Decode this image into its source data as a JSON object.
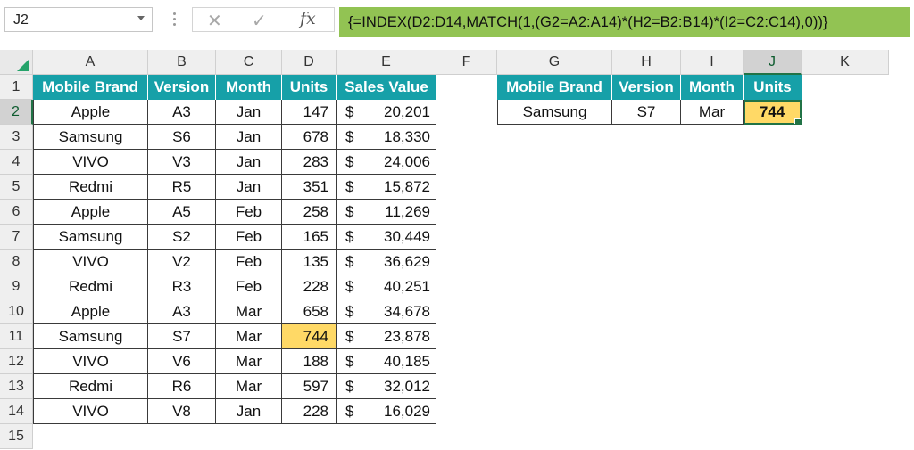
{
  "formula_bar": {
    "name_box": "J2",
    "cancel_icon": "✕",
    "enter_icon": "✓",
    "fx_label": "fx",
    "formula": "{=INDEX(D2:D14,MATCH(1,(G2=A2:A14)*(H2=B2:B14)*(I2=C2:C14),0))}"
  },
  "columns": [
    "A",
    "B",
    "C",
    "D",
    "E",
    "F",
    "G",
    "H",
    "I",
    "J",
    "K"
  ],
  "rows": [
    "1",
    "2",
    "3",
    "4",
    "5",
    "6",
    "7",
    "8",
    "9",
    "10",
    "11",
    "12",
    "13",
    "14",
    "15"
  ],
  "main_table": {
    "headers": [
      "Mobile Brand",
      "Version",
      "Month",
      "Units",
      "Sales Value"
    ],
    "currency_symbol": "$",
    "rows": [
      {
        "brand": "Apple",
        "version": "A3",
        "month": "Jan",
        "units": "147",
        "sales": "20,201"
      },
      {
        "brand": "Samsung",
        "version": "S6",
        "month": "Jan",
        "units": "678",
        "sales": "18,330"
      },
      {
        "brand": "VIVO",
        "version": "V3",
        "month": "Jan",
        "units": "283",
        "sales": "24,006"
      },
      {
        "brand": "Redmi",
        "version": "R5",
        "month": "Jan",
        "units": "351",
        "sales": "15,872"
      },
      {
        "brand": "Apple",
        "version": "A5",
        "month": "Feb",
        "units": "258",
        "sales": "11,269"
      },
      {
        "brand": "Samsung",
        "version": "S2",
        "month": "Feb",
        "units": "165",
        "sales": "30,449"
      },
      {
        "brand": "VIVO",
        "version": "V2",
        "month": "Feb",
        "units": "135",
        "sales": "36,629"
      },
      {
        "brand": "Redmi",
        "version": "R3",
        "month": "Feb",
        "units": "228",
        "sales": "40,251"
      },
      {
        "brand": "Apple",
        "version": "A3",
        "month": "Mar",
        "units": "658",
        "sales": "34,678"
      },
      {
        "brand": "Samsung",
        "version": "S7",
        "month": "Mar",
        "units": "744",
        "sales": "23,878",
        "highlight": true
      },
      {
        "brand": "VIVO",
        "version": "V6",
        "month": "Mar",
        "units": "188",
        "sales": "40,185"
      },
      {
        "brand": "Redmi",
        "version": "R6",
        "month": "Mar",
        "units": "597",
        "sales": "32,012"
      },
      {
        "brand": "VIVO",
        "version": "V8",
        "month": "Jan",
        "units": "228",
        "sales": "16,029"
      }
    ]
  },
  "lookup_table": {
    "headers": [
      "Mobile Brand",
      "Version",
      "Month",
      "Units"
    ],
    "brand": "Samsung",
    "version": "S7",
    "month": "Mar",
    "result": "744"
  },
  "colors": {
    "header_fill": "#16a0a8",
    "highlight_fill": "#ffd966",
    "formula_fill": "#92c353",
    "selection": "#217346"
  }
}
